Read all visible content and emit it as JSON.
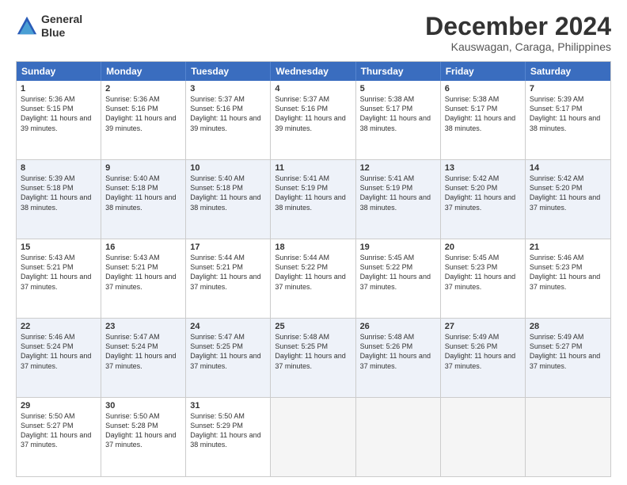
{
  "header": {
    "logo_line1": "General",
    "logo_line2": "Blue",
    "title": "December 2024",
    "subtitle": "Kauswagan, Caraga, Philippines"
  },
  "calendar": {
    "days": [
      "Sunday",
      "Monday",
      "Tuesday",
      "Wednesday",
      "Thursday",
      "Friday",
      "Saturday"
    ],
    "rows": [
      [
        {
          "day": "1",
          "sunrise": "5:36 AM",
          "sunset": "5:15 PM",
          "daylight": "11 hours and 39 minutes."
        },
        {
          "day": "2",
          "sunrise": "5:36 AM",
          "sunset": "5:16 PM",
          "daylight": "11 hours and 39 minutes."
        },
        {
          "day": "3",
          "sunrise": "5:37 AM",
          "sunset": "5:16 PM",
          "daylight": "11 hours and 39 minutes."
        },
        {
          "day": "4",
          "sunrise": "5:37 AM",
          "sunset": "5:16 PM",
          "daylight": "11 hours and 39 minutes."
        },
        {
          "day": "5",
          "sunrise": "5:38 AM",
          "sunset": "5:17 PM",
          "daylight": "11 hours and 38 minutes."
        },
        {
          "day": "6",
          "sunrise": "5:38 AM",
          "sunset": "5:17 PM",
          "daylight": "11 hours and 38 minutes."
        },
        {
          "day": "7",
          "sunrise": "5:39 AM",
          "sunset": "5:17 PM",
          "daylight": "11 hours and 38 minutes."
        }
      ],
      [
        {
          "day": "8",
          "sunrise": "5:39 AM",
          "sunset": "5:18 PM",
          "daylight": "11 hours and 38 minutes."
        },
        {
          "day": "9",
          "sunrise": "5:40 AM",
          "sunset": "5:18 PM",
          "daylight": "11 hours and 38 minutes."
        },
        {
          "day": "10",
          "sunrise": "5:40 AM",
          "sunset": "5:18 PM",
          "daylight": "11 hours and 38 minutes."
        },
        {
          "day": "11",
          "sunrise": "5:41 AM",
          "sunset": "5:19 PM",
          "daylight": "11 hours and 38 minutes."
        },
        {
          "day": "12",
          "sunrise": "5:41 AM",
          "sunset": "5:19 PM",
          "daylight": "11 hours and 38 minutes."
        },
        {
          "day": "13",
          "sunrise": "5:42 AM",
          "sunset": "5:20 PM",
          "daylight": "11 hours and 37 minutes."
        },
        {
          "day": "14",
          "sunrise": "5:42 AM",
          "sunset": "5:20 PM",
          "daylight": "11 hours and 37 minutes."
        }
      ],
      [
        {
          "day": "15",
          "sunrise": "5:43 AM",
          "sunset": "5:21 PM",
          "daylight": "11 hours and 37 minutes."
        },
        {
          "day": "16",
          "sunrise": "5:43 AM",
          "sunset": "5:21 PM",
          "daylight": "11 hours and 37 minutes."
        },
        {
          "day": "17",
          "sunrise": "5:44 AM",
          "sunset": "5:21 PM",
          "daylight": "11 hours and 37 minutes."
        },
        {
          "day": "18",
          "sunrise": "5:44 AM",
          "sunset": "5:22 PM",
          "daylight": "11 hours and 37 minutes."
        },
        {
          "day": "19",
          "sunrise": "5:45 AM",
          "sunset": "5:22 PM",
          "daylight": "11 hours and 37 minutes."
        },
        {
          "day": "20",
          "sunrise": "5:45 AM",
          "sunset": "5:23 PM",
          "daylight": "11 hours and 37 minutes."
        },
        {
          "day": "21",
          "sunrise": "5:46 AM",
          "sunset": "5:23 PM",
          "daylight": "11 hours and 37 minutes."
        }
      ],
      [
        {
          "day": "22",
          "sunrise": "5:46 AM",
          "sunset": "5:24 PM",
          "daylight": "11 hours and 37 minutes."
        },
        {
          "day": "23",
          "sunrise": "5:47 AM",
          "sunset": "5:24 PM",
          "daylight": "11 hours and 37 minutes."
        },
        {
          "day": "24",
          "sunrise": "5:47 AM",
          "sunset": "5:25 PM",
          "daylight": "11 hours and 37 minutes."
        },
        {
          "day": "25",
          "sunrise": "5:48 AM",
          "sunset": "5:25 PM",
          "daylight": "11 hours and 37 minutes."
        },
        {
          "day": "26",
          "sunrise": "5:48 AM",
          "sunset": "5:26 PM",
          "daylight": "11 hours and 37 minutes."
        },
        {
          "day": "27",
          "sunrise": "5:49 AM",
          "sunset": "5:26 PM",
          "daylight": "11 hours and 37 minutes."
        },
        {
          "day": "28",
          "sunrise": "5:49 AM",
          "sunset": "5:27 PM",
          "daylight": "11 hours and 37 minutes."
        }
      ],
      [
        {
          "day": "29",
          "sunrise": "5:50 AM",
          "sunset": "5:27 PM",
          "daylight": "11 hours and 37 minutes."
        },
        {
          "day": "30",
          "sunrise": "5:50 AM",
          "sunset": "5:28 PM",
          "daylight": "11 hours and 37 minutes."
        },
        {
          "day": "31",
          "sunrise": "5:50 AM",
          "sunset": "5:29 PM",
          "daylight": "11 hours and 38 minutes."
        },
        null,
        null,
        null,
        null
      ]
    ]
  }
}
